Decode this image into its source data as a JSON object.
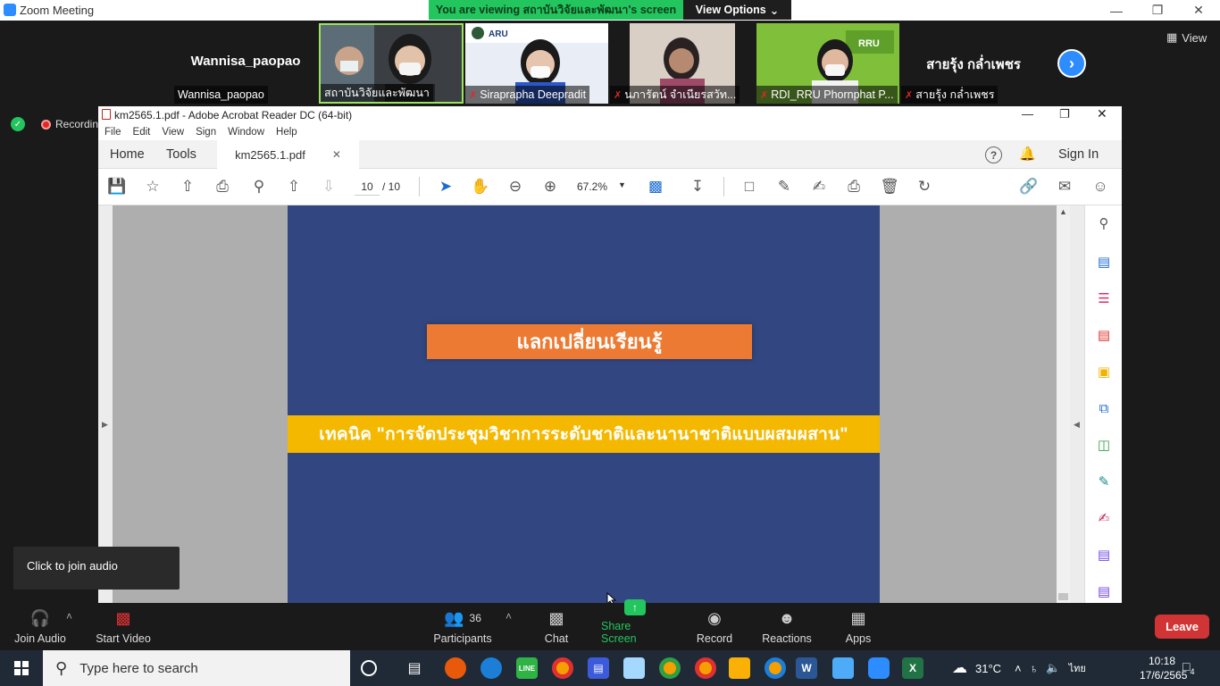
{
  "zoom": {
    "window_title": "Zoom Meeting",
    "banner": "You are viewing สถาบันวิจัยและพัฒนา's screen",
    "view_options": "View Options",
    "view_label": "View"
  },
  "participants": [
    {
      "big": "Wannisa_paopao",
      "name": "Wannisa_paopao",
      "muted": false
    },
    {
      "name": "สถาบันวิจัยและพัฒนา",
      "muted": false
    },
    {
      "name": "Siraprapha Deepradit",
      "muted": true
    },
    {
      "name": "นภารัตน์ จำเนียรสวัท...",
      "muted": true
    },
    {
      "name": "RDI_RRU Phornphat P...",
      "muted": true
    },
    {
      "big": "สายรุ้ง กล่ำเพชร",
      "name": "สายรุ้ง กล่ำเพชร",
      "muted": true
    }
  ],
  "recording_label": "Recordin",
  "acrobat": {
    "title": "km2565.1.pdf - Adobe Acrobat Reader DC (64-bit)",
    "menu": [
      "File",
      "Edit",
      "View",
      "Sign",
      "Window",
      "Help"
    ],
    "tabs": {
      "home": "Home",
      "tools": "Tools",
      "doc": "km2565.1.pdf"
    },
    "sign_in": "Sign In",
    "page_current": "10",
    "page_total": "/ 10",
    "zoom_level": "67.2%"
  },
  "document": {
    "heading": "แลกเปลี่ยนเรียนรู้",
    "band": "เทคนิค \"การจัดประชุมวิชาการระดับชาติและนานาชาติแบบผสมผสาน\""
  },
  "join_tip": "Click to join audio",
  "controls": {
    "join_audio": "Join Audio",
    "start_video": "Start Video",
    "participants": "Participants",
    "participants_count": "36",
    "chat": "Chat",
    "share_screen": "Share Screen",
    "record": "Record",
    "reactions": "Reactions",
    "apps": "Apps",
    "leave": "Leave"
  },
  "taskbar": {
    "search_placeholder": "Type here to search",
    "weather": "31°C",
    "lang": "ไทย",
    "time": "10:18",
    "date": "17/6/2565",
    "notifications": "4"
  },
  "colors": {
    "zoom_blue": "#2d8cff",
    "share_green": "#23c55e",
    "page_blue": "#324781",
    "orange": "#ec7a32",
    "yellow": "#f5b800",
    "leave_red": "#d13434"
  }
}
